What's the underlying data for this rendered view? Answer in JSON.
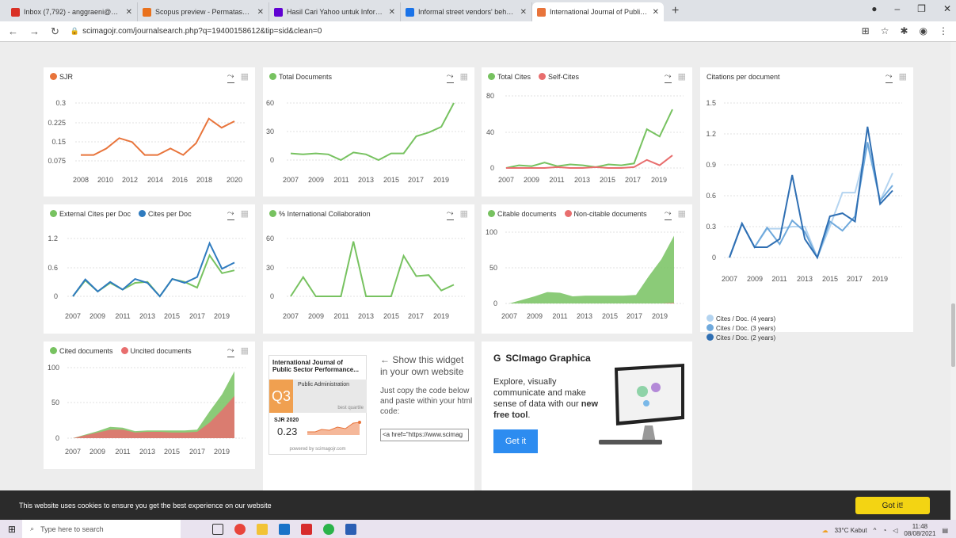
{
  "browser": {
    "tabs": [
      {
        "label": "Inbox (7,792) - anggraeni@pres",
        "color": "#d93025"
      },
      {
        "label": "Scopus preview - Permatasari, A",
        "color": "#e9711c"
      },
      {
        "label": "Hasil Cari Yahoo untuk Informal",
        "color": "#6001d2"
      },
      {
        "label": "Informal street vendors' behavio",
        "color": "#1a73e8"
      },
      {
        "label": "International Journal of Public Se",
        "color": "#e8743b"
      }
    ],
    "new_tab": "+",
    "url": "scimagojr.com/journalsearch.php?q=19400158612&tip=sid&clean=0"
  },
  "charts": {
    "sjr": {
      "legend": [
        "SJR"
      ],
      "colors": [
        "#e8743b"
      ],
      "yticks": [
        "0.3",
        "0.225",
        "0.15",
        "0.075"
      ],
      "xticks": [
        "2008",
        "2010",
        "2012",
        "2014",
        "2016",
        "2018",
        "2020"
      ]
    },
    "total_docs": {
      "legend": [
        "Total Documents"
      ],
      "colors": [
        "#77c260"
      ],
      "yticks": [
        "60",
        "30",
        "0"
      ],
      "xticks": [
        "2007",
        "2009",
        "2011",
        "2013",
        "2015",
        "2017",
        "2019"
      ]
    },
    "total_cites": {
      "legend": [
        "Total Cites",
        "Self-Cites"
      ],
      "colors": [
        "#77c260",
        "#e86e6e"
      ],
      "yticks": [
        "80",
        "40",
        "0"
      ],
      "xticks": [
        "2007",
        "2009",
        "2011",
        "2013",
        "2015",
        "2017",
        "2019"
      ]
    },
    "cites_per_doc": {
      "title": "Citations per document",
      "yticks": [
        "1.5",
        "1.2",
        "0.9",
        "0.6",
        "0.3",
        "0"
      ],
      "xticks": [
        "2007",
        "2009",
        "2011",
        "2013",
        "2015",
        "2017",
        "2019"
      ],
      "legend": [
        "Cites / Doc. (4 years)",
        "Cites / Doc. (3 years)",
        "Cites / Doc. (2 years)"
      ],
      "colors": [
        "#b4d4f0",
        "#6fa9dc",
        "#2f6fb3"
      ]
    },
    "ext_cites": {
      "legend": [
        "External Cites per Doc",
        "Cites per Doc"
      ],
      "colors": [
        "#77c260",
        "#2f7bbf"
      ],
      "yticks": [
        "1.2",
        "0.6",
        "0"
      ],
      "xticks": [
        "2007",
        "2009",
        "2011",
        "2013",
        "2015",
        "2017",
        "2019"
      ]
    },
    "intl_collab": {
      "legend": [
        "% International Collaboration"
      ],
      "colors": [
        "#77c260"
      ],
      "yticks": [
        "60",
        "30",
        "0"
      ],
      "xticks": [
        "2007",
        "2009",
        "2011",
        "2013",
        "2015",
        "2017",
        "2019"
      ]
    },
    "citable": {
      "legend": [
        "Citable documents",
        "Non-citable documents"
      ],
      "colors": [
        "#77c260",
        "#e86e6e"
      ],
      "yticks": [
        "100",
        "50",
        "0"
      ],
      "xticks": [
        "2007",
        "2009",
        "2011",
        "2013",
        "2015",
        "2017",
        "2019"
      ]
    },
    "cited": {
      "legend": [
        "Cited documents",
        "Uncited documents"
      ],
      "colors": [
        "#77c260",
        "#e86e6e"
      ],
      "yticks": [
        "100",
        "50",
        "0"
      ],
      "xticks": [
        "2007",
        "2009",
        "2011",
        "2013",
        "2015",
        "2017",
        "2019"
      ]
    }
  },
  "chart_data": [
    {
      "type": "line",
      "x": [
        2008,
        2009,
        2010,
        2011,
        2012,
        2013,
        2014,
        2015,
        2016,
        2017,
        2018,
        2019,
        2020
      ],
      "series": [
        {
          "name": "SJR",
          "values": [
            0.1,
            0.1,
            0.125,
            0.165,
            0.15,
            0.1,
            0.1,
            0.125,
            0.1,
            0.145,
            0.24,
            0.205,
            0.23
          ]
        }
      ],
      "ylim": [
        0.05,
        0.3
      ]
    },
    {
      "type": "line",
      "x": [
        2007,
        2008,
        2009,
        2010,
        2011,
        2012,
        2013,
        2014,
        2015,
        2016,
        2017,
        2018,
        2019,
        2020
      ],
      "series": [
        {
          "name": "Total Documents",
          "values": [
            7,
            6,
            7,
            6,
            0,
            8,
            6,
            0,
            7,
            7,
            25,
            29,
            35,
            60
          ]
        }
      ],
      "ylim": [
        0,
        60
      ]
    },
    {
      "type": "line",
      "x": [
        2007,
        2008,
        2009,
        2010,
        2011,
        2012,
        2013,
        2014,
        2015,
        2016,
        2017,
        2018,
        2019,
        2020
      ],
      "series": [
        {
          "name": "Total Cites",
          "values": [
            0,
            3,
            2,
            6,
            2,
            4,
            3,
            1,
            4,
            3,
            5,
            43,
            35,
            65
          ]
        },
        {
          "name": "Self-Cites",
          "values": [
            0,
            0,
            0,
            0,
            1,
            0,
            0,
            1,
            0,
            0,
            1,
            9,
            3,
            14
          ]
        }
      ],
      "ylim": [
        0,
        80
      ]
    },
    {
      "type": "line",
      "x": [
        2007,
        2008,
        2009,
        2010,
        2011,
        2012,
        2013,
        2014,
        2015,
        2016,
        2017,
        2018,
        2019,
        2020
      ],
      "series": [
        {
          "name": "Cites / Doc. (4 years)",
          "values": [
            0,
            0.33,
            0.1,
            0.28,
            0.28,
            0.3,
            0.3,
            0,
            0.3,
            0.63,
            0.63,
            1.1,
            0.55,
            0.82
          ]
        },
        {
          "name": "Cites / Doc. (3 years)",
          "values": [
            0,
            0.33,
            0.1,
            0.29,
            0.13,
            0.36,
            0.25,
            0,
            0.35,
            0.26,
            0.4,
            1.12,
            0.55,
            0.7
          ]
        },
        {
          "name": "Cites / Doc. (2 years)",
          "values": [
            0,
            0.33,
            0.1,
            0.1,
            0.18,
            0.8,
            0.18,
            0,
            0.4,
            0.43,
            0.35,
            1.27,
            0.52,
            0.65
          ]
        }
      ],
      "ylim": [
        0,
        1.5
      ]
    },
    {
      "type": "line",
      "x": [
        2007,
        2008,
        2009,
        2010,
        2011,
        2012,
        2013,
        2014,
        2015,
        2016,
        2017,
        2018,
        2019,
        2020
      ],
      "series": [
        {
          "name": "External Cites per Doc",
          "values": [
            0,
            0.33,
            0.1,
            0.28,
            0.14,
            0.28,
            0.3,
            0,
            0.36,
            0.3,
            0.18,
            0.85,
            0.48,
            0.54
          ]
        },
        {
          "name": "Cites per Doc",
          "values": [
            0,
            0.35,
            0.1,
            0.3,
            0.14,
            0.36,
            0.28,
            0,
            0.36,
            0.28,
            0.4,
            1.1,
            0.57,
            0.7
          ]
        }
      ],
      "ylim": [
        0,
        1.2
      ]
    },
    {
      "type": "line",
      "x": [
        2007,
        2008,
        2009,
        2010,
        2011,
        2012,
        2013,
        2014,
        2015,
        2016,
        2017,
        2018,
        2019,
        2020
      ],
      "series": [
        {
          "name": "% International Collaboration",
          "values": [
            0,
            20,
            0,
            0,
            0,
            57,
            0,
            0,
            0,
            42,
            21,
            22,
            6,
            12
          ]
        }
      ],
      "ylim": [
        0,
        60
      ]
    },
    {
      "type": "area",
      "x": [
        2007,
        2008,
        2009,
        2010,
        2011,
        2012,
        2013,
        2014,
        2015,
        2016,
        2017,
        2018,
        2019,
        2020
      ],
      "series": [
        {
          "name": "Citable documents",
          "values": [
            0,
            5,
            10,
            16,
            15,
            10,
            11,
            11,
            11,
            11,
            12,
            38,
            62,
            95
          ]
        },
        {
          "name": "Non-citable documents",
          "values": [
            0,
            0,
            0,
            0,
            0,
            0,
            0,
            0,
            0,
            0,
            0,
            0,
            0,
            1
          ]
        }
      ],
      "ylim": [
        0,
        100
      ]
    },
    {
      "type": "area",
      "x": [
        2007,
        2008,
        2009,
        2010,
        2011,
        2012,
        2013,
        2014,
        2015,
        2016,
        2017,
        2018,
        2019,
        2020
      ],
      "series": [
        {
          "name": "Cited documents",
          "values": [
            0,
            5,
            10,
            16,
            15,
            10,
            11,
            11,
            11,
            11,
            12,
            38,
            62,
            95
          ]
        },
        {
          "name": "Uncited documents",
          "values": [
            0,
            4,
            8,
            12,
            12,
            8,
            9,
            9,
            8,
            8,
            9,
            22,
            40,
            60
          ]
        }
      ],
      "ylim": [
        0,
        100
      ]
    }
  ],
  "widget": {
    "journal": "International Journal of Public Sector Performance...",
    "quartile": "Q3",
    "category": "Public Administration",
    "best_quartile": "best quartile",
    "sjr_label": "SJR 2020",
    "sjr_value": "0.23",
    "powered": "powered by scimagojr.com",
    "show_text": "← Show this widget in your own website",
    "copy_text": "Just copy the code below and paste within your html code:",
    "code": "<a href=\"https://www.scimag"
  },
  "graphica": {
    "title": "SCImago Graphica",
    "text_pre": "Explore, visually communicate and make sense of data with our ",
    "text_bold": "new free tool",
    "text_post": ".",
    "button": "Get it"
  },
  "cookie": {
    "text": "This website uses cookies to ensure you get the best experience on our website",
    "button": "Got it!"
  },
  "taskbar": {
    "search": "Type here to search",
    "weather": "33°C  Kabut",
    "time": "11:48",
    "date": "08/08/2021"
  }
}
